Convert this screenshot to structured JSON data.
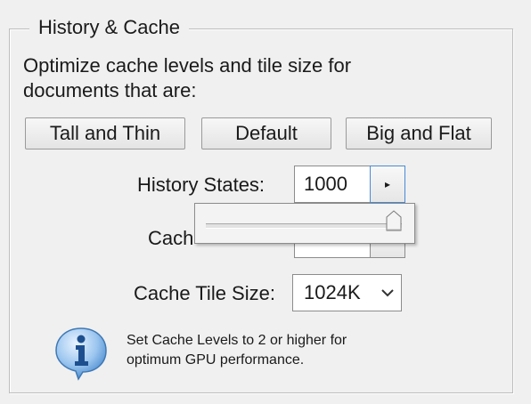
{
  "group": {
    "title": "History & Cache"
  },
  "description": {
    "line1": "Optimize cache levels and tile size for",
    "line2": "documents that are:"
  },
  "presets": {
    "tall_and_thin": "Tall and Thin",
    "default": "Default",
    "big_and_flat": "Big and Flat"
  },
  "history_states": {
    "label": "History States:",
    "value": "1000",
    "arrow_glyph": "▸",
    "slider_fraction": 1.0
  },
  "cache_levels": {
    "label_visible": "Cach"
  },
  "cache_tile_size": {
    "label": "Cache Tile Size:",
    "value": "1024K",
    "chevron_glyph": "⌵"
  },
  "info": {
    "icon": "info-icon",
    "line1": "Set Cache Levels to 2 or higher for",
    "line2": "optimum GPU performance."
  }
}
